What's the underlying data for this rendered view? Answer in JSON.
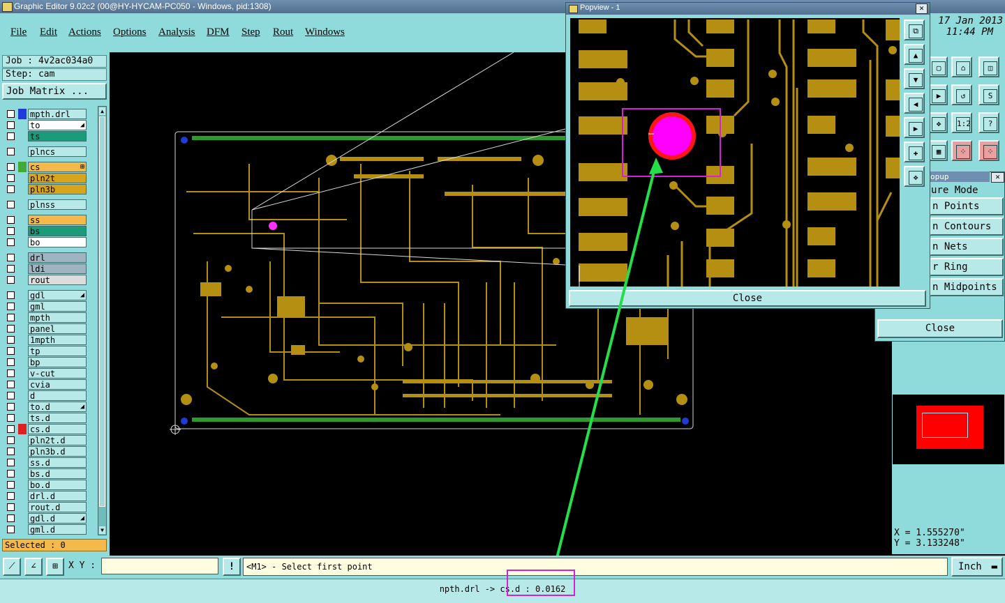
{
  "window": {
    "title": "Graphic Editor 9.02c2 (00@HY-HYCAM-PC050 - Windows, pid:1308)"
  },
  "menu": [
    "File",
    "Edit",
    "Actions",
    "Options",
    "Analysis",
    "DFM",
    "Step",
    "Rout",
    "Windows"
  ],
  "job": {
    "job_label": "Job : 4v2ac034a0",
    "step_label": "Step: cam",
    "matrix_button": "Job Matrix ..."
  },
  "layers": [
    {
      "name": "mpth.drl",
      "bg": "#b7e9e9",
      "swatch": "#1f3bd8",
      "mark": ""
    },
    {
      "name": "to",
      "bg": "#ffffff",
      "swatch": "",
      "mark": "◢"
    },
    {
      "name": "ts",
      "bg": "#1a9b7a",
      "swatch": "",
      "mark": ""
    },
    {
      "name": "plncs",
      "bg": "#b7e9e9",
      "swatch": "",
      "mark": ""
    },
    {
      "name": "cs",
      "bg": "#f3b94a",
      "swatch": "#41a83a",
      "mark": "⊞"
    },
    {
      "name": "pln2t",
      "bg": "#d7a51d",
      "swatch": "",
      "mark": ""
    },
    {
      "name": "pln3b",
      "bg": "#d7a51d",
      "swatch": "",
      "mark": ""
    },
    {
      "name": "plnss",
      "bg": "#b7e9e9",
      "swatch": "",
      "mark": ""
    },
    {
      "name": "ss",
      "bg": "#f3b94a",
      "swatch": "",
      "mark": ""
    },
    {
      "name": "bs",
      "bg": "#1a9b7a",
      "swatch": "",
      "mark": ""
    },
    {
      "name": "bo",
      "bg": "#ffffff",
      "swatch": "",
      "mark": ""
    },
    {
      "name": "drl",
      "bg": "#9fb4c0",
      "swatch": "",
      "mark": ""
    },
    {
      "name": "ldi",
      "bg": "#9fb4c0",
      "swatch": "",
      "mark": ""
    },
    {
      "name": "rout",
      "bg": "#dcdcdc",
      "swatch": "",
      "mark": ""
    },
    {
      "name": "gdl",
      "bg": "#b7e9e9",
      "swatch": "",
      "mark": "◢"
    },
    {
      "name": "gml",
      "bg": "#b7e9e9",
      "swatch": "",
      "mark": ""
    },
    {
      "name": "mpth",
      "bg": "#b7e9e9",
      "swatch": "",
      "mark": ""
    },
    {
      "name": "panel",
      "bg": "#b7e9e9",
      "swatch": "",
      "mark": ""
    },
    {
      "name": "1mpth",
      "bg": "#b7e9e9",
      "swatch": "",
      "mark": ""
    },
    {
      "name": "tp",
      "bg": "#b7e9e9",
      "swatch": "",
      "mark": ""
    },
    {
      "name": "bp",
      "bg": "#b7e9e9",
      "swatch": "",
      "mark": ""
    },
    {
      "name": "v-cut",
      "bg": "#b7e9e9",
      "swatch": "",
      "mark": ""
    },
    {
      "name": "cvia",
      "bg": "#b7e9e9",
      "swatch": "",
      "mark": ""
    },
    {
      "name": "d",
      "bg": "#b7e9e9",
      "swatch": "",
      "mark": ""
    },
    {
      "name": "to.d",
      "bg": "#b7e9e9",
      "swatch": "",
      "mark": "◢"
    },
    {
      "name": "ts.d",
      "bg": "#b7e9e9",
      "swatch": "",
      "mark": ""
    },
    {
      "name": "cs.d",
      "bg": "#b7e9e9",
      "swatch": "#e02020",
      "mark": ""
    },
    {
      "name": "pln2t.d",
      "bg": "#b7e9e9",
      "swatch": "",
      "mark": ""
    },
    {
      "name": "pln3b.d",
      "bg": "#b7e9e9",
      "swatch": "",
      "mark": ""
    },
    {
      "name": "ss.d",
      "bg": "#b7e9e9",
      "swatch": "",
      "mark": ""
    },
    {
      "name": "bs.d",
      "bg": "#b7e9e9",
      "swatch": "",
      "mark": ""
    },
    {
      "name": "bo.d",
      "bg": "#b7e9e9",
      "swatch": "",
      "mark": ""
    },
    {
      "name": "drl.d",
      "bg": "#b7e9e9",
      "swatch": "",
      "mark": ""
    },
    {
      "name": "rout.d",
      "bg": "#b7e9e9",
      "swatch": "",
      "mark": ""
    },
    {
      "name": "gdl.d",
      "bg": "#b7e9e9",
      "swatch": "",
      "mark": "◢"
    },
    {
      "name": "gml.d",
      "bg": "#b7e9e9",
      "swatch": "",
      "mark": ""
    }
  ],
  "selected": "Selected : 0",
  "date": "17 Jan 2013",
  "time": "11:44 PM",
  "popview": {
    "title": "Popview - 1",
    "close": "Close"
  },
  "snap_popup": {
    "title": "opup",
    "items": [
      "ure Mode",
      "n Points",
      "n Contours",
      "n Nets",
      "r Ring",
      "n Midpoints"
    ],
    "close": "Close"
  },
  "coords": {
    "x": "X  =  1.555270\"",
    "y": "Y  =  3.133248\""
  },
  "bottom": {
    "xy_label": "X Y :",
    "xy_value": "",
    "prompt": "<M1> - Select first point",
    "units": "Inch",
    "measure": "npth.drl -> cs.d : 0.0162"
  },
  "colors": {
    "copper": "#b58f12",
    "board_bg": "#000000",
    "panel": "#8fdada",
    "accent_arrow": "#23e04a",
    "highlight_box": "#d81ed8"
  }
}
